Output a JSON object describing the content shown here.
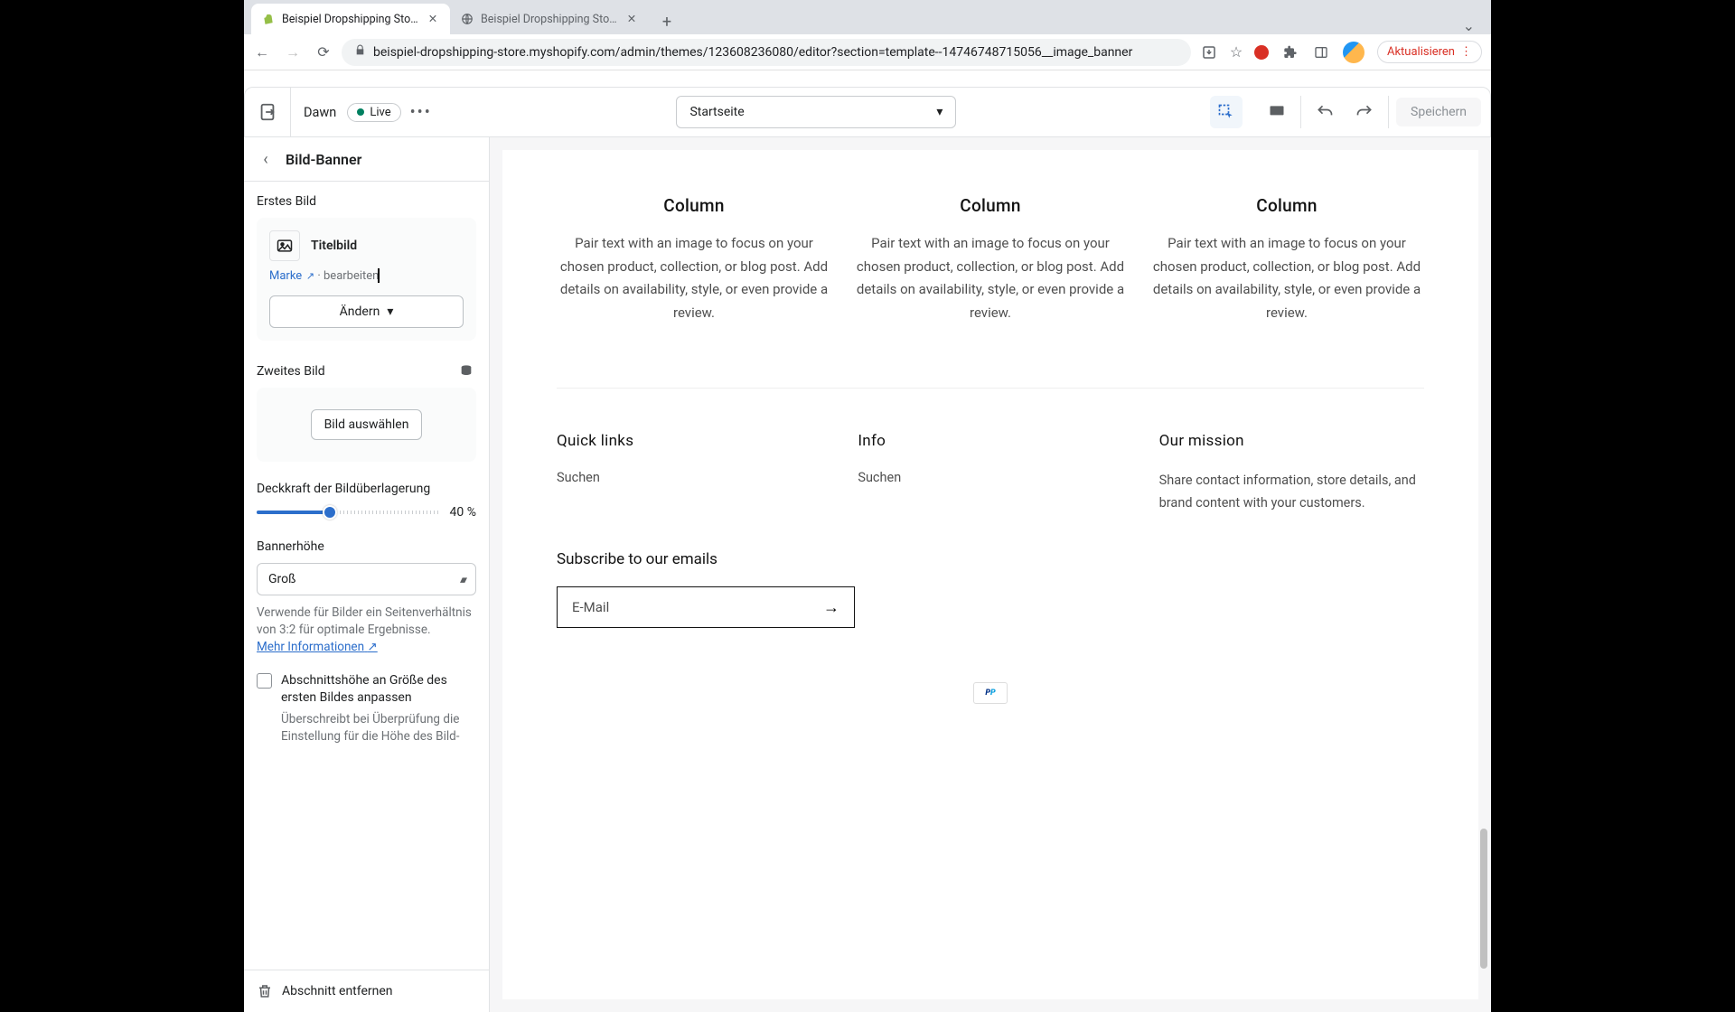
{
  "browser": {
    "tabs": [
      {
        "title": "Beispiel Dropshipping Store · D",
        "active": true
      },
      {
        "title": "Beispiel Dropshipping Store",
        "active": false
      }
    ],
    "url": "beispiel-dropshipping-store.myshopify.com/admin/themes/123608236080/editor?section=template--14746748715056__image_banner",
    "update_label": "Aktualisieren"
  },
  "editor": {
    "theme_name": "Dawn",
    "badge": "Live",
    "page_select": "Startseite",
    "save_label": "Speichern"
  },
  "sidebar": {
    "title": "Bild-Banner",
    "first_image": {
      "label": "Erstes Bild",
      "name": "Titelbild",
      "brand_link": "Marke",
      "edit_text": "bearbeiten",
      "change_btn": "Ändern"
    },
    "second_image": {
      "label": "Zweites Bild",
      "select_btn": "Bild auswählen"
    },
    "overlay": {
      "label": "Deckkraft der Bildüberlagerung",
      "value_text": "40 %",
      "percent": 40
    },
    "banner_height": {
      "label": "Bannerhöhe",
      "value": "Groß",
      "help": "Verwende für Bilder ein Seitenverhältnis von 3:2 für optimale Ergebnisse.",
      "more_info": "Mehr Informationen"
    },
    "checkbox": {
      "label": "Abschnittshöhe an Größe des ersten Bildes anpassen",
      "desc": "Überschreibt bei Überprüfung die Einstellung für die Höhe des Bild-"
    },
    "remove": "Abschnitt entfernen"
  },
  "preview": {
    "columns": [
      {
        "title": "Column",
        "text": "Pair text with an image to focus on your chosen product, collection, or blog post. Add details on availability, style, or even provide a review."
      },
      {
        "title": "Column",
        "text": "Pair text with an image to focus on your chosen product, collection, or blog post. Add details on availability, style, or even provide a review."
      },
      {
        "title": "Column",
        "text": "Pair text with an image to focus on your chosen product, collection, or blog post. Add details on availability, style, or even provide a review."
      }
    ],
    "footer": {
      "quick_links": {
        "title": "Quick links",
        "link1": "Suchen"
      },
      "info": {
        "title": "Info",
        "link1": "Suchen"
      },
      "mission": {
        "title": "Our mission",
        "text": "Share contact information, store details, and brand content with your customers."
      }
    },
    "subscribe": {
      "title": "Subscribe to our emails",
      "placeholder": "E-Mail"
    }
  }
}
